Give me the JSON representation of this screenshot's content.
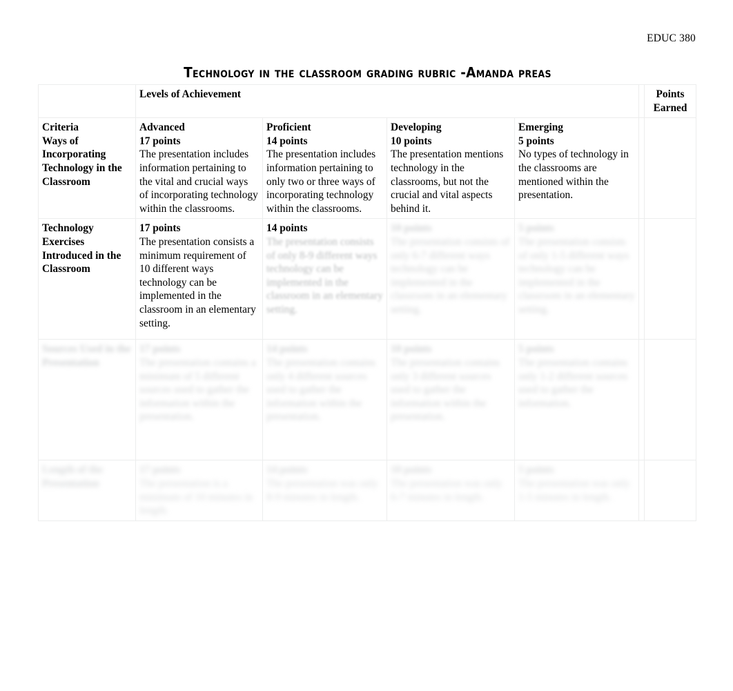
{
  "header": {
    "course_code": "EDUC 380"
  },
  "title": "Technology in the classroom grading rubric -Amanda preas",
  "table": {
    "levels_label": "Levels of Achievement",
    "points_earned_header": "Points Earned",
    "criteria_header": "Criteria",
    "levels": [
      {
        "name": "Advanced",
        "points": "17 points"
      },
      {
        "name": "Proficient",
        "points": "14 points"
      },
      {
        "name": "Developing",
        "points": "10 points"
      },
      {
        "name": "Emerging",
        "points": "5 points"
      }
    ],
    "rows": [
      {
        "criteria": "Ways of Incorporating Technology in the Classroom",
        "cells": [
          {
            "points": "17 points",
            "text": "The presentation includes information pertaining to the vital and crucial ways of incorporating technology within the classrooms."
          },
          {
            "points": "14 points",
            "text": "The presentation includes information pertaining to only two or three ways of incorporating technology within the classrooms."
          },
          {
            "points": "10 points",
            "text": "The presentation mentions technology in the classrooms, but not the crucial and vital aspects behind it."
          },
          {
            "points": "5 points",
            "text": "No types of technology in the classrooms are mentioned within the presentation."
          }
        ],
        "points_earned": ""
      },
      {
        "criteria": "Technology Exercises Introduced in the Classroom",
        "cells": [
          {
            "points": "17 points",
            "text": "The presentation consists a minimum requirement of 10 different ways technology can be implemented in the classroom in an elementary setting."
          },
          {
            "points": "14 points",
            "text": "The presentation consists of only 8-9 different ways technology can be implemented in the classroom in an elementary setting."
          },
          {
            "points": "10 points",
            "text": "The presentation consists of only 6-7 different ways technology can be implemented in the classroom in an elementary setting."
          },
          {
            "points": "5 points",
            "text": "The presentation consists of only 1-5 different ways technology can be implemented in the classroom in an elementary setting."
          }
        ],
        "points_earned": ""
      },
      {
        "criteria": "Sources Used in the Presentation",
        "cells": [
          {
            "points": "17 points",
            "text": "The presentation contains a minimum of 5 different sources used to gather the information within the presentation."
          },
          {
            "points": "14 points",
            "text": "The presentation contains only 4 different sources used to gather the information within the presentation."
          },
          {
            "points": "10 points",
            "text": "The presentation contains only 3 different sources used to gather the information within the presentation."
          },
          {
            "points": "5 points",
            "text": "The presentation contains only 1-2 different sources used to gather the information."
          }
        ],
        "points_earned": ""
      },
      {
        "criteria": "Length of the Presentation",
        "cells": [
          {
            "points": "17 points",
            "text": "The presentation is a minimum of 10 minutes in length."
          },
          {
            "points": "14 points",
            "text": "The presentation was only 8-9 minutes in length."
          },
          {
            "points": "10 points",
            "text": "The presentation was only 6-7 minutes in length."
          },
          {
            "points": "5 points",
            "text": "The presentation was only 1-5 minutes in length."
          }
        ],
        "points_earned": ""
      }
    ]
  }
}
